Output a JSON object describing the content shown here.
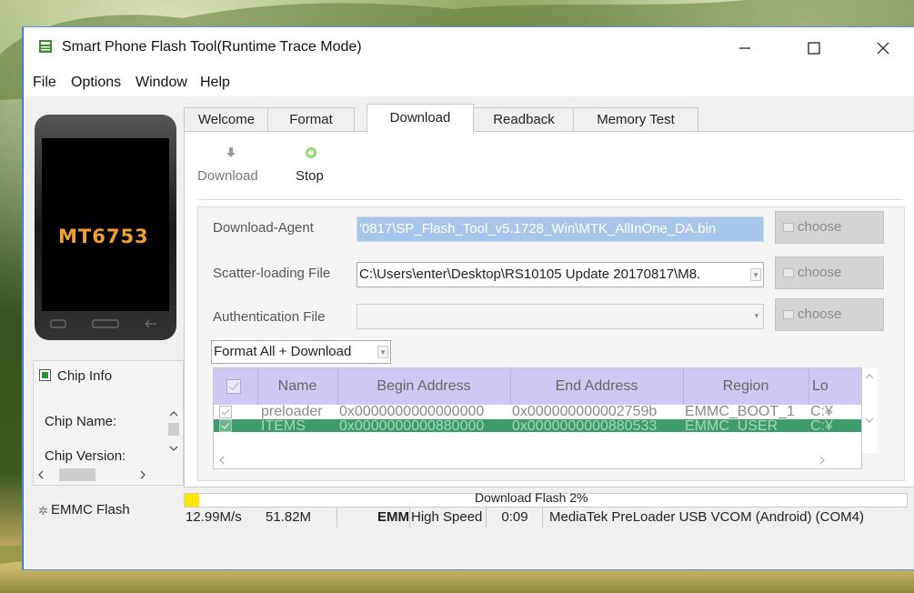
{
  "window": {
    "title": "Smart Phone Flash Tool(Runtime Trace Mode)",
    "icon": "flash-tool-icon",
    "controls": {
      "minimize": "—",
      "maximize": "☐",
      "close": "✕"
    }
  },
  "menu": [
    "File",
    "Options",
    "Window",
    "Help"
  ],
  "device": {
    "chip_label": "MT6753"
  },
  "chip_info": {
    "title": "Chip Info",
    "rows": [
      "Chip Name:",
      "Chip Version:"
    ]
  },
  "storage_label": "EMMC Flash",
  "tabs": [
    {
      "label": "Welcome"
    },
    {
      "label": "Format"
    },
    {
      "label": "Download",
      "active": true
    },
    {
      "label": "Readback"
    },
    {
      "label": "Memory Test"
    }
  ],
  "toolbar": {
    "download": "Download",
    "stop": "Stop"
  },
  "form": {
    "download_agent": {
      "label": "Download-Agent",
      "value": "'0817\\SP_Flash_Tool_v5.1728_Win\\MTK_AllInOne_DA.bin"
    },
    "scatter": {
      "label": "Scatter-loading File",
      "value": "C:\\Users\\enter\\Desktop\\RS10105 Update 20170817\\M8."
    },
    "auth": {
      "label": "Authentication File",
      "value": ""
    },
    "choose_label": "choose",
    "mode": "Format All + Download"
  },
  "table": {
    "columns": [
      "",
      "Name",
      "Begin Address",
      "End Address",
      "Region",
      "Lo"
    ],
    "rows": [
      {
        "name": "preloader",
        "begin": "0x0000000000000000",
        "end": "0x000000000002759b",
        "region": "EMMC_BOOT_1",
        "location": "C:¥"
      },
      {
        "name": "ITEMS",
        "begin": "0x0000000000880000",
        "end": "0x0000000000880533",
        "region": "EMMC_USER",
        "location": "C:¥"
      }
    ]
  },
  "progress": {
    "label": "Download Flash 2%",
    "percent": 2,
    "color": "#ffe600"
  },
  "status": {
    "speed": "12.99M/s",
    "size": "51.82M",
    "storage": "EMM",
    "usb": "High Speed",
    "time": "0:09",
    "port": "MediaTek PreLoader USB VCOM (Android) (COM4)"
  }
}
